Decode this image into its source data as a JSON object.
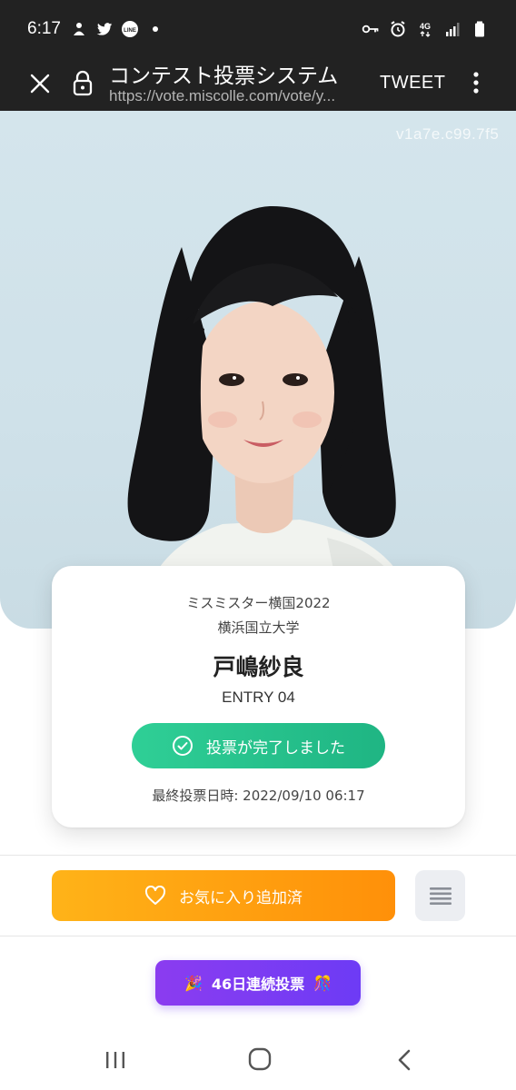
{
  "status_bar": {
    "time": "6:17",
    "network": "4G"
  },
  "toolbar": {
    "title": "コンテスト投票システム",
    "url": "https://vote.miscolle.com/vote/y...",
    "tweet_label": "TWEET"
  },
  "hero": {
    "watermark": "v1a7e.c99.7f5"
  },
  "card": {
    "contest": "ミスミスター横国2022",
    "university": "横浜国立大学",
    "name": "戸嶋紗良",
    "entry": "ENTRY 04",
    "vote_done_label": "投票が完了しました",
    "last_vote": "最終投票日時: 2022/09/10 06:17"
  },
  "favorite_button": {
    "label": "お気に入り追加済"
  },
  "streak": {
    "label": "46日連続投票",
    "left_emoji": "🎉",
    "right_emoji": "🎊"
  },
  "colors": {
    "bar_bg": "#222222",
    "vote_green": "#22bd88",
    "fav_orange": "#ff9f0f",
    "streak_purple": "#7c3bf2"
  }
}
